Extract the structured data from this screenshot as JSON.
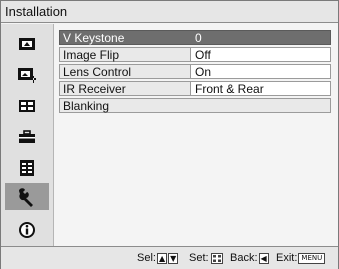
{
  "menu": {
    "title": "Installation"
  },
  "sidebar": {
    "items": [
      {
        "icon": "picture-icon"
      },
      {
        "icon": "advanced-picture-icon"
      },
      {
        "icon": "screen-icon"
      },
      {
        "icon": "setup-icon"
      },
      {
        "icon": "function-icon"
      },
      {
        "icon": "installation-wrench-icon",
        "selected": true
      },
      {
        "icon": "information-icon"
      }
    ]
  },
  "settings": [
    {
      "label": "V Keystone",
      "value": "0",
      "selected": true
    },
    {
      "label": "Image Flip",
      "value": "Off"
    },
    {
      "label": "Lens Control",
      "value": "On"
    },
    {
      "label": "IR Receiver",
      "value": "Front & Rear"
    },
    {
      "label": "Blanking",
      "value": ""
    }
  ],
  "footer": {
    "sel_label": "Sel:",
    "sel_keys": [
      "▲",
      "▼"
    ],
    "set_label": "Set:",
    "back_label": "Back:",
    "back_key": "◀",
    "exit_label": "Exit:",
    "exit_key": "MENU"
  },
  "colors": {
    "selected_row": "#6e6e6e",
    "selected_icon": "#9a9a9a"
  }
}
